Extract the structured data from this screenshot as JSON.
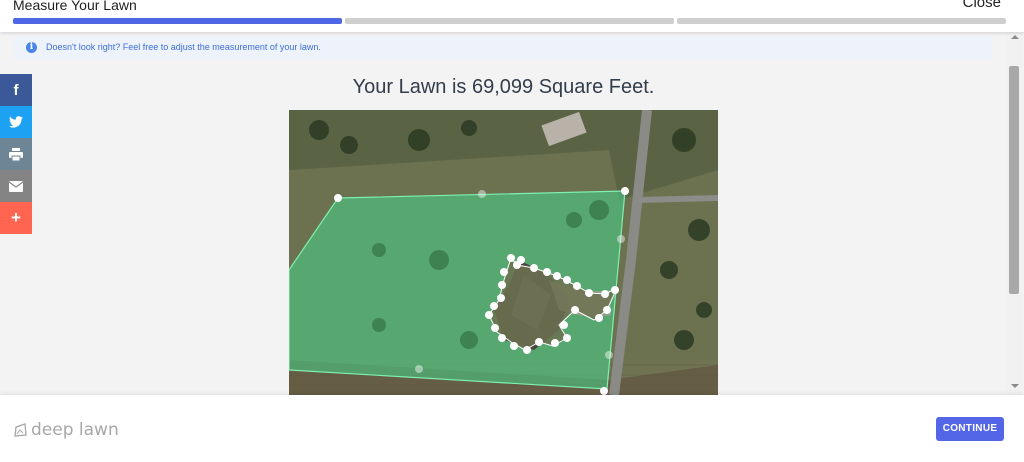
{
  "modal": {
    "title": "Measure Your Lawn",
    "close_label": "Close"
  },
  "progress": {
    "steps_total": 3,
    "current_step": 1
  },
  "info": {
    "icon": "info-icon",
    "message": "Doesn't look right? Feel free to adjust the measurement of your lawn."
  },
  "result": {
    "headline": "Your Lawn is 69,099 Square Feet."
  },
  "map": {
    "view": "satellite",
    "polygon_color": "#47d48a"
  },
  "social": [
    {
      "name": "facebook",
      "icon": "facebook-icon",
      "glyph": "f",
      "color": "#3b5998"
    },
    {
      "name": "twitter",
      "icon": "twitter-icon",
      "glyph": "",
      "color": "#1da1f2"
    },
    {
      "name": "print",
      "icon": "print-icon",
      "glyph": "",
      "color": "#6d8595"
    },
    {
      "name": "email",
      "icon": "email-icon",
      "glyph": "",
      "color": "#848484"
    },
    {
      "name": "more",
      "icon": "plus-icon",
      "glyph": "+",
      "color": "#ff6550"
    }
  ],
  "footer": {
    "brand": "deep lawn",
    "continue_label": "CONTINUE"
  },
  "colors": {
    "accent": "#4f67e6",
    "button": "#5466e8"
  }
}
